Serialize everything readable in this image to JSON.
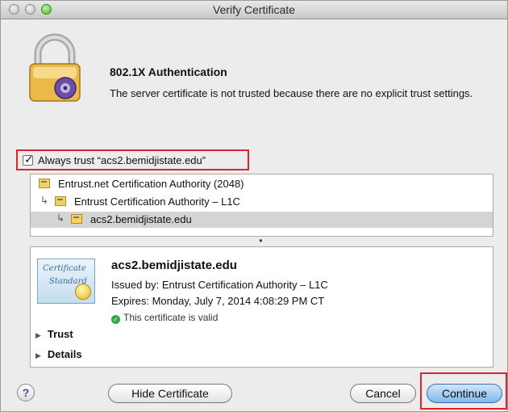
{
  "window": {
    "title": "Verify Certificate"
  },
  "auth": {
    "heading": "802.1X Authentication",
    "message": "The server certificate is not trusted because there are no explicit trust settings."
  },
  "trust_checkbox": {
    "label": "Always trust “acs2.bemidjistate.edu”",
    "checked": true
  },
  "cert_chain": [
    {
      "label": "Entrust.net Certification Authority (2048)",
      "level": 0,
      "selected": false
    },
    {
      "label": "Entrust Certification Authority – L1C",
      "level": 1,
      "selected": false
    },
    {
      "label": "acs2.bemidjistate.edu",
      "level": 2,
      "selected": true
    }
  ],
  "details": {
    "name": "acs2.bemidjistate.edu",
    "issued_by": "Issued by: Entrust Certification Authority – L1C",
    "expires": "Expires: Monday, July 7, 2014 4:08:29 PM CT",
    "status": "This certificate is valid",
    "sections": [
      "Trust",
      "Details"
    ],
    "icon_text": [
      "Certificate",
      "Standard"
    ]
  },
  "buttons": {
    "help": "?",
    "hide_certificate": "Hide Certificate",
    "cancel": "Cancel",
    "continue": "Continue"
  },
  "colors": {
    "highlight": "#d9262a",
    "default_button": "#7fb8ec",
    "valid": "#2fa84a"
  }
}
